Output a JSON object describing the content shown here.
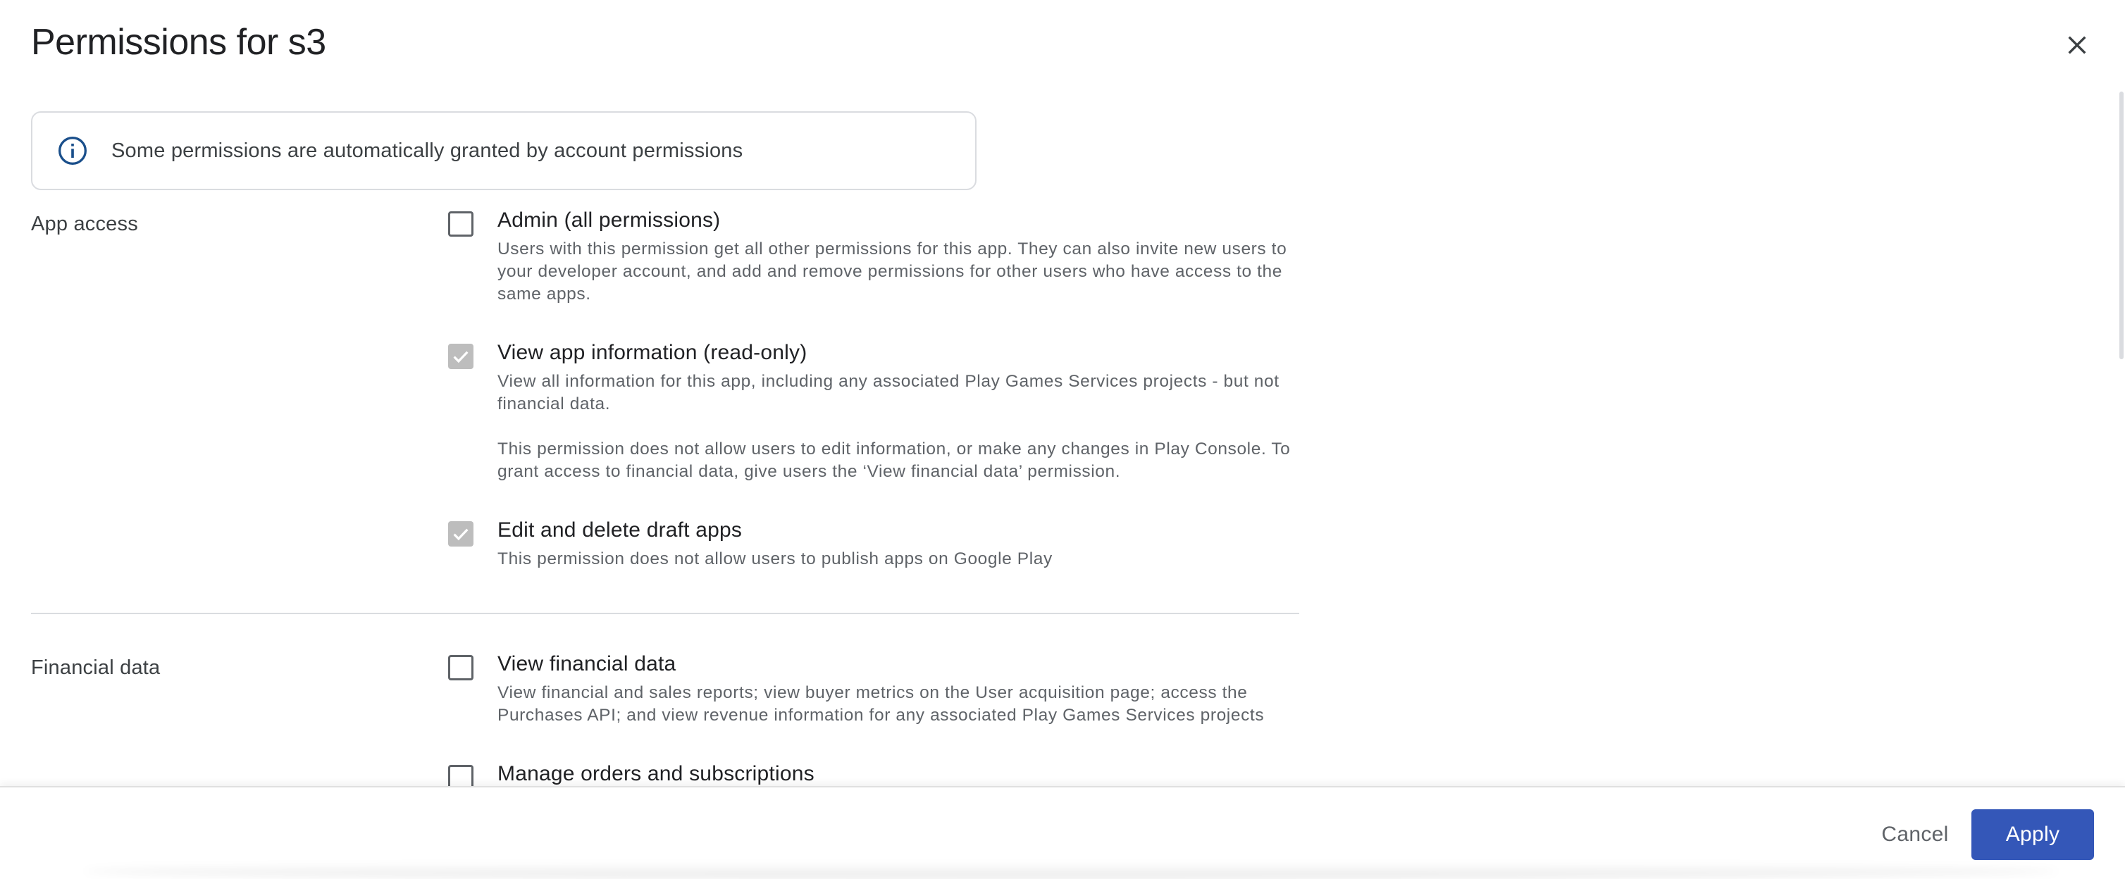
{
  "dialog": {
    "title": "Permissions for s3"
  },
  "info_banner": {
    "icon": "info-icon",
    "text": "Some permissions are automatically granted by account permissions"
  },
  "sections": [
    {
      "label": "App access",
      "permissions": [
        {
          "title": "Admin (all permissions)",
          "checked": false,
          "disabled": false,
          "description": "Users with this permission get all other permissions for this app. They can also invite new users to your developer account, and add and remove permissions for other users who have access to the same apps."
        },
        {
          "title": "View app information (read-only)",
          "checked": true,
          "disabled": true,
          "description": "View all information for this app, including any associated Play Games Services projects - but not financial data.",
          "description2": "This permission does not allow users to edit information, or make any changes in Play Console. To grant access to financial data, give users the ‘View financial data’ permission."
        },
        {
          "title": "Edit and delete draft apps",
          "checked": true,
          "disabled": true,
          "description": "This permission does not allow users to publish apps on Google Play"
        }
      ]
    },
    {
      "label": "Financial data",
      "permissions": [
        {
          "title": "View financial data",
          "checked": false,
          "disabled": false,
          "description": "View financial and sales reports; view buyer metrics on the User acquisition page; access the Purchases API; and view revenue information for any associated Play Games Services projects"
        },
        {
          "title": "Manage orders and subscriptions",
          "checked": false,
          "disabled": false
        }
      ]
    }
  ],
  "footer": {
    "cancel_label": "Cancel",
    "apply_label": "Apply"
  },
  "colors": {
    "primary": "#3457b8",
    "disabled_check": "#bdbdbd",
    "border": "#dadce0"
  }
}
